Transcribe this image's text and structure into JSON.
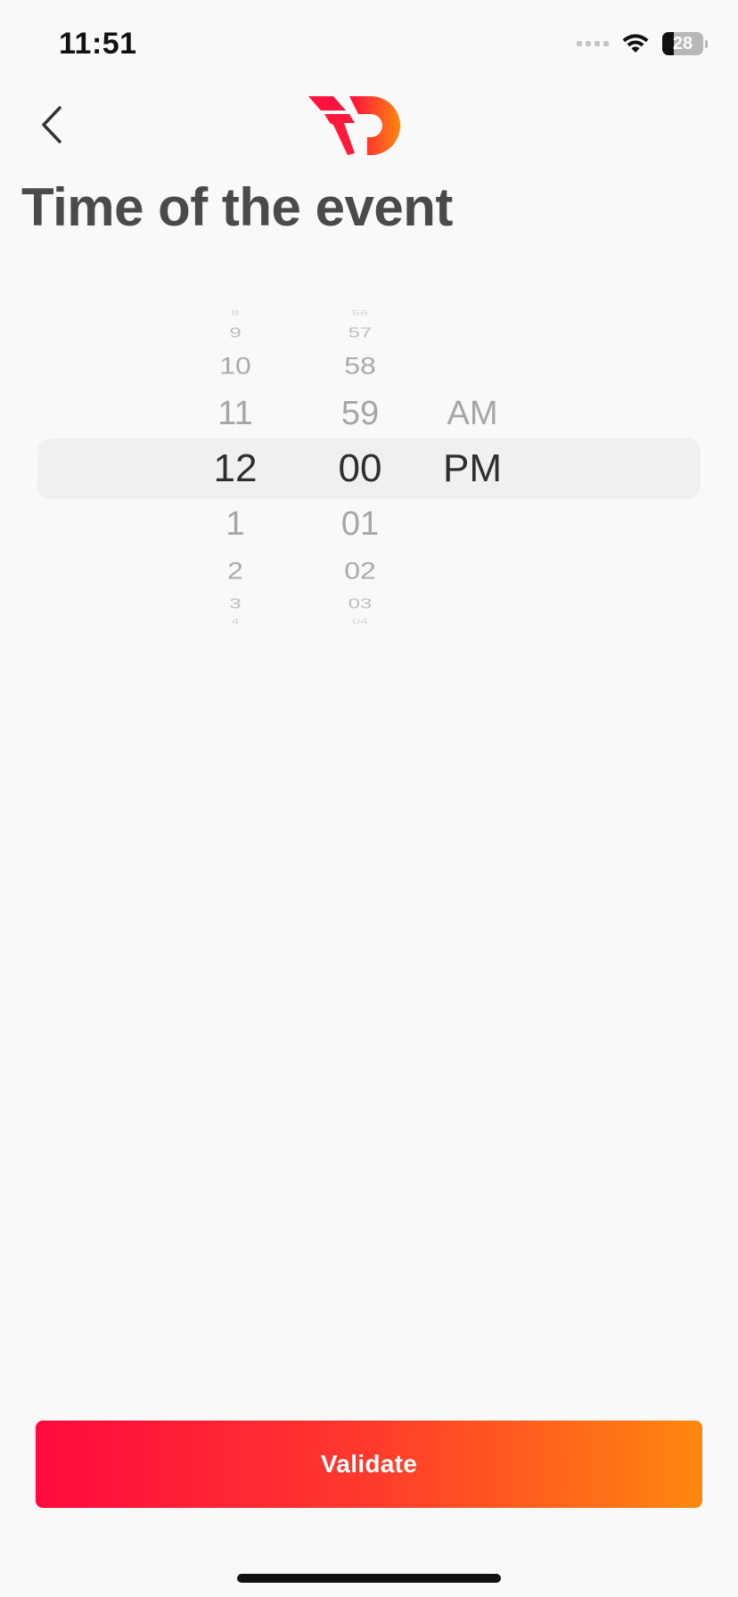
{
  "status_bar": {
    "time": "11:51",
    "battery_level": "28"
  },
  "header": {
    "title": "Time of the event",
    "logo_colors": [
      "#ff0a3f",
      "#ff870f"
    ]
  },
  "picker": {
    "hours": {
      "above": [
        "8",
        "9",
        "10",
        "11"
      ],
      "selected": "12",
      "below": [
        "1",
        "2",
        "3",
        "4"
      ]
    },
    "minutes": {
      "above": [
        "56",
        "57",
        "58",
        "59"
      ],
      "selected": "00",
      "below": [
        "01",
        "02",
        "03",
        "04"
      ]
    },
    "ampm": {
      "above": [
        "AM"
      ],
      "selected": "PM"
    }
  },
  "footer": {
    "validate_label": "Validate"
  },
  "colors": {
    "background": "#f9f9f9",
    "title": "#4a4a4a",
    "gradient_start": "#ff0a3f",
    "gradient_end": "#ff870f"
  }
}
